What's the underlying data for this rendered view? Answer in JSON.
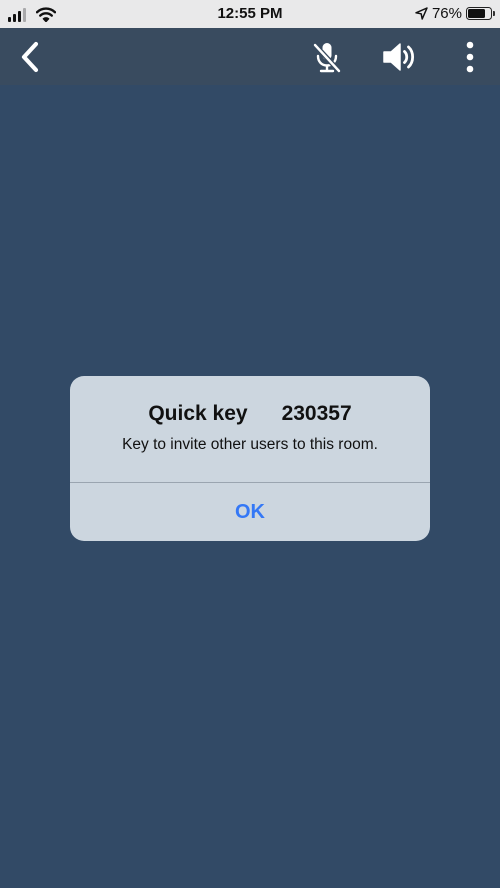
{
  "status_bar": {
    "time": "12:55 PM",
    "battery_percent": "76%",
    "battery_level": 0.76,
    "signal_bars_active": 3,
    "signal_bars_total": 4
  },
  "nav_bar": {
    "icons": [
      "back-chevron-icon",
      "mic-muted-icon",
      "speaker-icon",
      "more-vertical-icon"
    ]
  },
  "dialog": {
    "title_label": "Quick key",
    "title_value": "230357",
    "message": "Key to invite other users to this room.",
    "ok_label": "OK"
  },
  "colors": {
    "background": "#324a66",
    "nav_bar": "#394b5f",
    "dialog_background": "#ccd6df",
    "accent": "#3478f6"
  }
}
